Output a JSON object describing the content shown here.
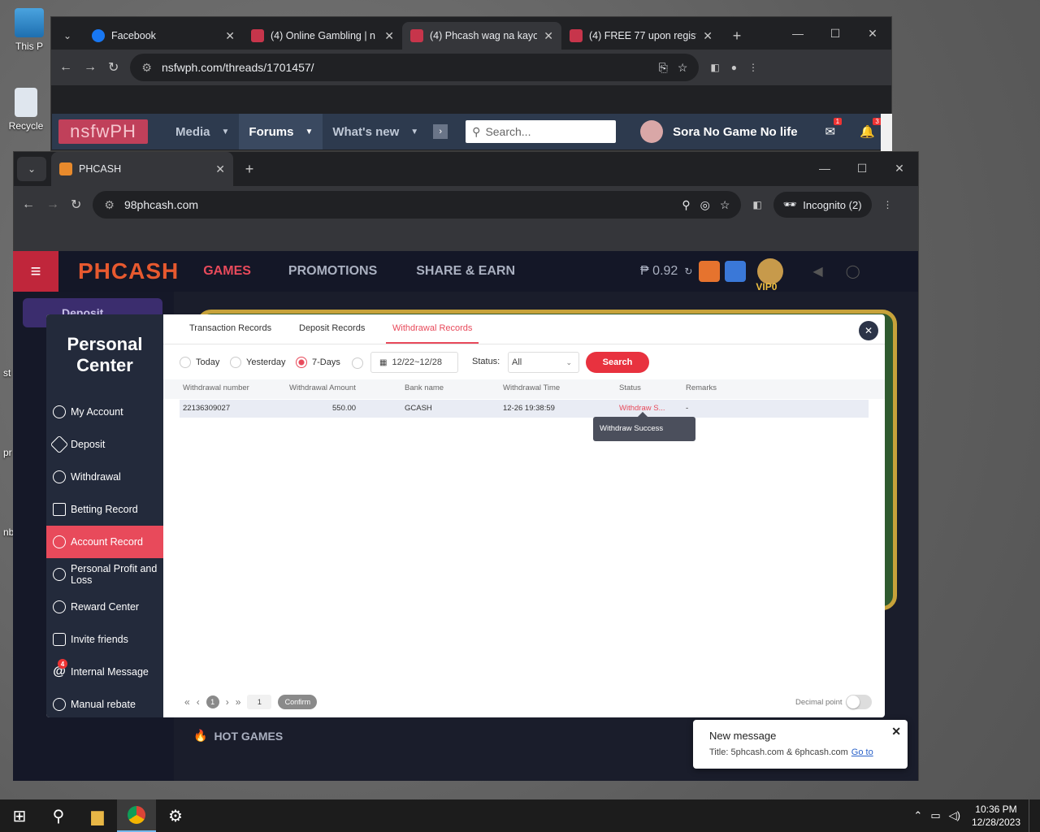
{
  "desktop": {
    "icons": [
      {
        "label": "This P",
        "name": "this-pc"
      },
      {
        "label": "Recycle",
        "name": "recycle-bin"
      }
    ],
    "side_fragments": [
      "st",
      "pr",
      "nb"
    ]
  },
  "browser1": {
    "tabs": [
      {
        "title": "Facebook",
        "icon": "facebook-icon",
        "active": false
      },
      {
        "title": "(4) Online Gambling | n",
        "icon": "shield-icon",
        "active": false
      },
      {
        "title": "(4) Phcash wag na kayo",
        "icon": "shield-icon",
        "active": true
      },
      {
        "title": "(4) FREE 77 upon regist",
        "icon": "shield-icon",
        "active": false
      }
    ],
    "url": "nsfwph.com/threads/1701457/",
    "site_nav": {
      "logo": "nsfwPH",
      "items": [
        "Media",
        "Forums",
        "What's new"
      ],
      "search_placeholder": "Search...",
      "username": "Sora No Game No life",
      "mail_badge": "1",
      "bell_badge": "3"
    }
  },
  "browser2": {
    "tab_title": "PHCASH",
    "url": "98phcash.com",
    "incognito_label": "Incognito (2)"
  },
  "site": {
    "logo": "PHCASH",
    "nav": [
      "GAMES",
      "PROMOTIONS",
      "SHARE & EARN"
    ],
    "balance": "₱ 0.92",
    "vip": "VIP0",
    "left_menu_first": "Deposit",
    "hot_games": "HOT GAMES"
  },
  "personal_center": {
    "title_line1": "Personal",
    "title_line2": "Center",
    "menu": [
      {
        "label": "My Account",
        "icon": "account-icon"
      },
      {
        "label": "Deposit",
        "icon": "deposit-icon"
      },
      {
        "label": "Withdrawal",
        "icon": "withdrawal-icon"
      },
      {
        "label": "Betting Record",
        "icon": "clipboard-icon"
      },
      {
        "label": "Account Record",
        "icon": "record-icon"
      },
      {
        "label": "Personal Profit and Loss",
        "icon": "profit-icon"
      },
      {
        "label": "Reward Center",
        "icon": "reward-icon"
      },
      {
        "label": "Invite friends",
        "icon": "invite-icon"
      },
      {
        "label": "Internal Message",
        "icon": "at-icon",
        "badge": "4"
      },
      {
        "label": "Manual rebate",
        "icon": "rebate-icon"
      }
    ],
    "active_index": 4
  },
  "records": {
    "tabs": [
      "Transaction Records",
      "Deposit Records",
      "Withdrawal Records"
    ],
    "active_tab": 2,
    "filters": {
      "options": [
        "Today",
        "Yesterday",
        "7-Days"
      ],
      "selected": "7-Days",
      "date_range": "12/22~12/28",
      "status_label": "Status:",
      "status_value": "All",
      "search_button": "Search"
    },
    "columns": [
      "Withdrawal number",
      "Withdrawal Amount",
      "Bank name",
      "Withdrawal Time",
      "Status",
      "Remarks"
    ],
    "rows": [
      {
        "number": "22136309027",
        "amount": "550.00",
        "bank": "GCASH",
        "time": "12-26 19:38:59",
        "status": "Withdraw S...",
        "remarks": "-"
      }
    ],
    "tooltip": "Withdraw Success",
    "pagination": {
      "page": "1",
      "goto_value": "1",
      "confirm": "Confirm"
    },
    "decimal_label": "Decimal point"
  },
  "notification": {
    "title": "New message",
    "body": "Title: 5phcash.com & 6phcash.com",
    "link": "Go to"
  },
  "taskbar": {
    "time": "10:36 PM",
    "date": "12/28/2023"
  }
}
